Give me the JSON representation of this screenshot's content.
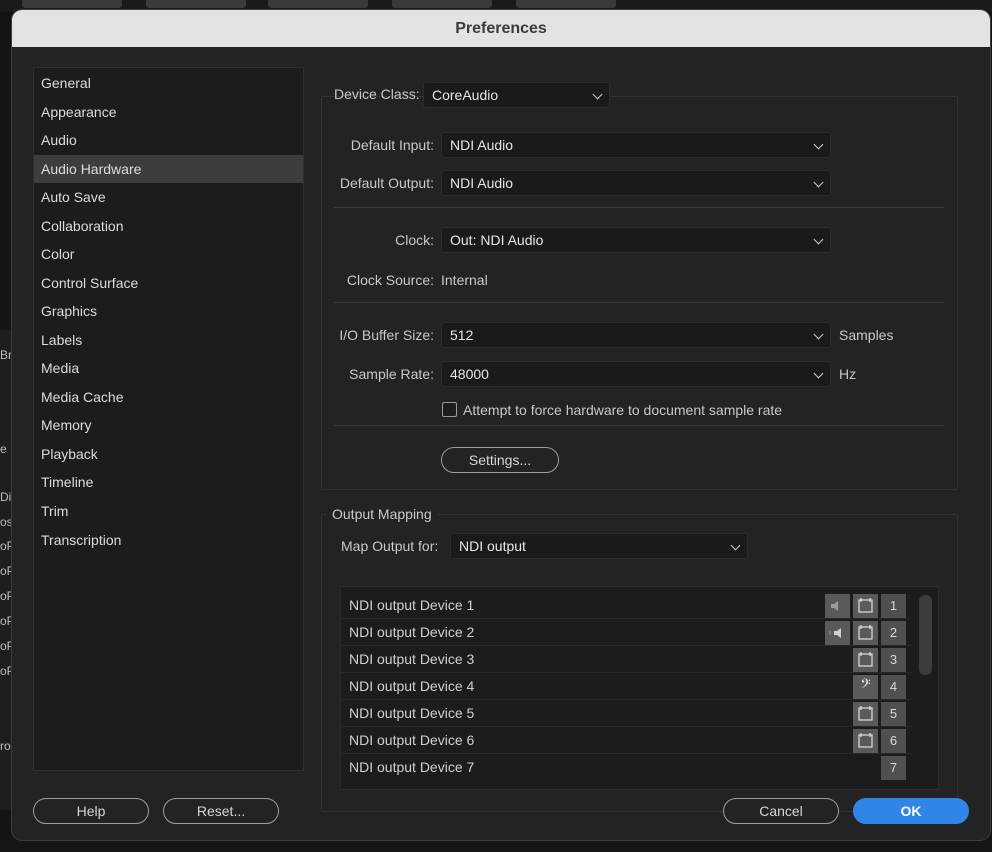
{
  "window": {
    "title": "Preferences"
  },
  "background": {
    "left_fragments": [
      "Br",
      "e",
      "Dis",
      "os",
      "oP",
      "oP",
      "oP",
      "oP",
      "oP",
      "oP",
      "ro"
    ]
  },
  "sidebar": {
    "items": [
      {
        "label": "General"
      },
      {
        "label": "Appearance"
      },
      {
        "label": "Audio"
      },
      {
        "label": "Audio Hardware",
        "selected": true
      },
      {
        "label": "Auto Save"
      },
      {
        "label": "Collaboration"
      },
      {
        "label": "Color"
      },
      {
        "label": "Control Surface"
      },
      {
        "label": "Graphics"
      },
      {
        "label": "Labels"
      },
      {
        "label": "Media"
      },
      {
        "label": "Media Cache"
      },
      {
        "label": "Memory"
      },
      {
        "label": "Playback"
      },
      {
        "label": "Timeline"
      },
      {
        "label": "Trim"
      },
      {
        "label": "Transcription"
      }
    ]
  },
  "device": {
    "device_class_label": "Device Class:",
    "device_class_value": "CoreAudio",
    "default_input_label": "Default Input:",
    "default_input_value": "NDI Audio",
    "default_output_label": "Default Output:",
    "default_output_value": "NDI Audio",
    "clock_label": "Clock:",
    "clock_value": "Out: NDI Audio",
    "clock_source_label": "Clock Source:",
    "clock_source_value": "Internal",
    "buffer_label": "I/O Buffer Size:",
    "buffer_value": "512",
    "buffer_unit": "Samples",
    "sample_rate_label": "Sample Rate:",
    "sample_rate_value": "48000",
    "sample_rate_unit": "Hz",
    "force_rate_label": "Attempt to force hardware to document sample rate",
    "force_rate_checked": false,
    "settings_button": "Settings..."
  },
  "output_mapping": {
    "group_label": "Output Mapping",
    "map_for_label": "Map Output for:",
    "map_for_value": "NDI output",
    "rows": [
      {
        "name": "NDI output Device 1",
        "channel": "1",
        "icons": [
          "speaker-left-icon",
          "track-target-icon"
        ]
      },
      {
        "name": "NDI output Device 2",
        "channel": "2",
        "icons": [
          "speaker-right-icon",
          "track-target-icon"
        ]
      },
      {
        "name": "NDI output Device 3",
        "channel": "3",
        "icons": [
          "track-target-icon"
        ]
      },
      {
        "name": "NDI output Device 4",
        "channel": "4",
        "icons": [
          "bass-clef-icon"
        ]
      },
      {
        "name": "NDI output Device 5",
        "channel": "5",
        "icons": [
          "track-target-icon"
        ]
      },
      {
        "name": "NDI output Device 6",
        "channel": "6",
        "icons": [
          "track-target-icon"
        ]
      },
      {
        "name": "NDI output Device 7",
        "channel": "7",
        "icons": []
      }
    ]
  },
  "footer": {
    "help_button": "Help",
    "reset_button": "Reset...",
    "cancel_button": "Cancel",
    "ok_button": "OK"
  },
  "colors": {
    "accent": "#2f86e6",
    "title_bar": "#e3e3e3",
    "panel": "#232323"
  }
}
